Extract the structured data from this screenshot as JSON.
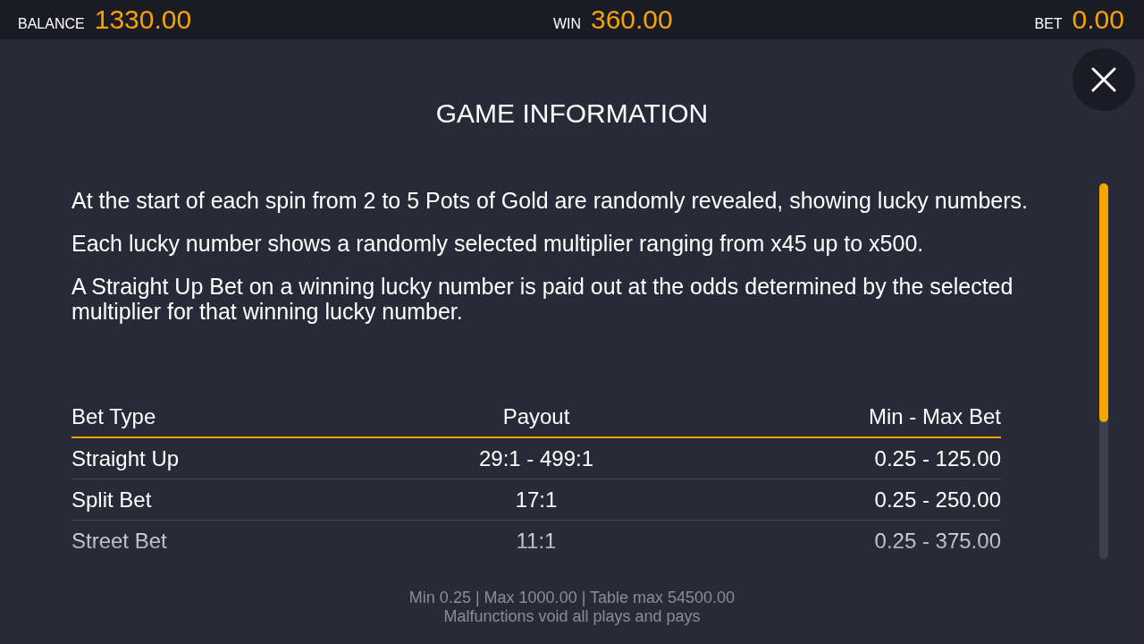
{
  "top_bar": {
    "stats": [
      {
        "label": "BALANCE",
        "value": "1330.00"
      },
      {
        "label": "WIN",
        "value": "360.00"
      },
      {
        "label": "BET",
        "value": "0.00"
      }
    ]
  },
  "title": "GAME INFORMATION",
  "paragraphs": [
    "At the start of each spin from 2 to 5 Pots of Gold are randomly revealed, showing lucky numbers.",
    "Each lucky number shows a randomly selected multiplier ranging from x45 up to x500.",
    "A Straight Up Bet on a winning lucky number is paid out at the odds determined by the selected multiplier for that winning lucky number."
  ],
  "table": {
    "columns": [
      "Bet Type",
      "Payout",
      "Min - Max Bet"
    ],
    "rows": [
      [
        "Straight Up",
        "29:1 - 499:1",
        "0.25 - 125.00"
      ],
      [
        "Split Bet",
        "17:1",
        "0.25 - 250.00"
      ],
      [
        "Street Bet",
        "11:1",
        "0.25 - 375.00"
      ]
    ]
  },
  "footer": [
    "Min 0.25 | Max 1000.00 | Table max 54500.00",
    "Malfunctions void all plays and pays"
  ]
}
